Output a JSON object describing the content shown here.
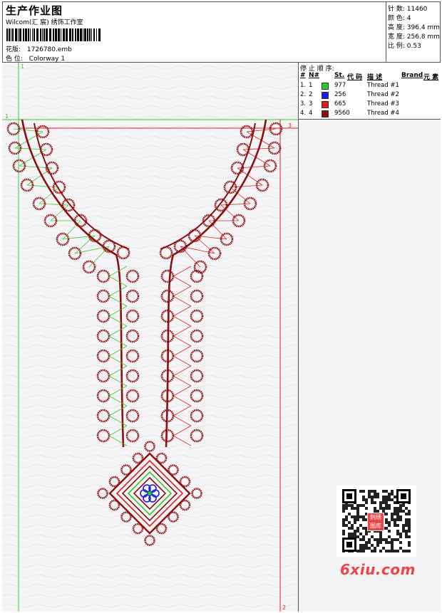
{
  "header": {
    "title": "生产作业图",
    "studio": "Wilcom(汇 宸) 绣饰工作室",
    "design_file_label": "花版:",
    "design_file": "1726780.emb",
    "colorway_label": "色 位:",
    "colorway": "Colorway 1"
  },
  "stats": {
    "stitches_label": "针 数:",
    "stitches": "11460",
    "colors_label": "颜 色:",
    "colors": "4",
    "height_label": "高 度:",
    "height": "396.4 mm",
    "width_label": "宽 度:",
    "width": "256.8 mm",
    "scale_label": "比 例:",
    "scale": "0.53"
  },
  "stop_sequence": {
    "title": "停 止 顺 序:",
    "columns": [
      "#",
      "N#",
      "St.",
      "代 码",
      "描 述",
      "Brand",
      "元 素"
    ],
    "rows": [
      {
        "index": "1.",
        "needle": "1",
        "code": "977",
        "desc": "Thread #1",
        "color": "#22cc22"
      },
      {
        "index": "2.",
        "needle": "2",
        "code": "256",
        "desc": "Thread #2",
        "color": "#1c1ce0"
      },
      {
        "index": "3.",
        "needle": "3",
        "code": "665",
        "desc": "Thread #3",
        "color": "#e01818"
      },
      {
        "index": "4.",
        "needle": "4",
        "code": "9560",
        "desc": "Thread #4",
        "color": "#8c1010"
      }
    ]
  },
  "guides": {
    "green_marker": "1",
    "green_marker_h": "1",
    "red_marker_top": "3",
    "red_marker_bottom": "2"
  },
  "watermark": {
    "site": "6xiu.com",
    "stamp": "刺绣图库"
  },
  "colors": {
    "guide_green": "#33cc33",
    "guide_red": "#dd2222",
    "thread_dark": "#8b1010"
  }
}
